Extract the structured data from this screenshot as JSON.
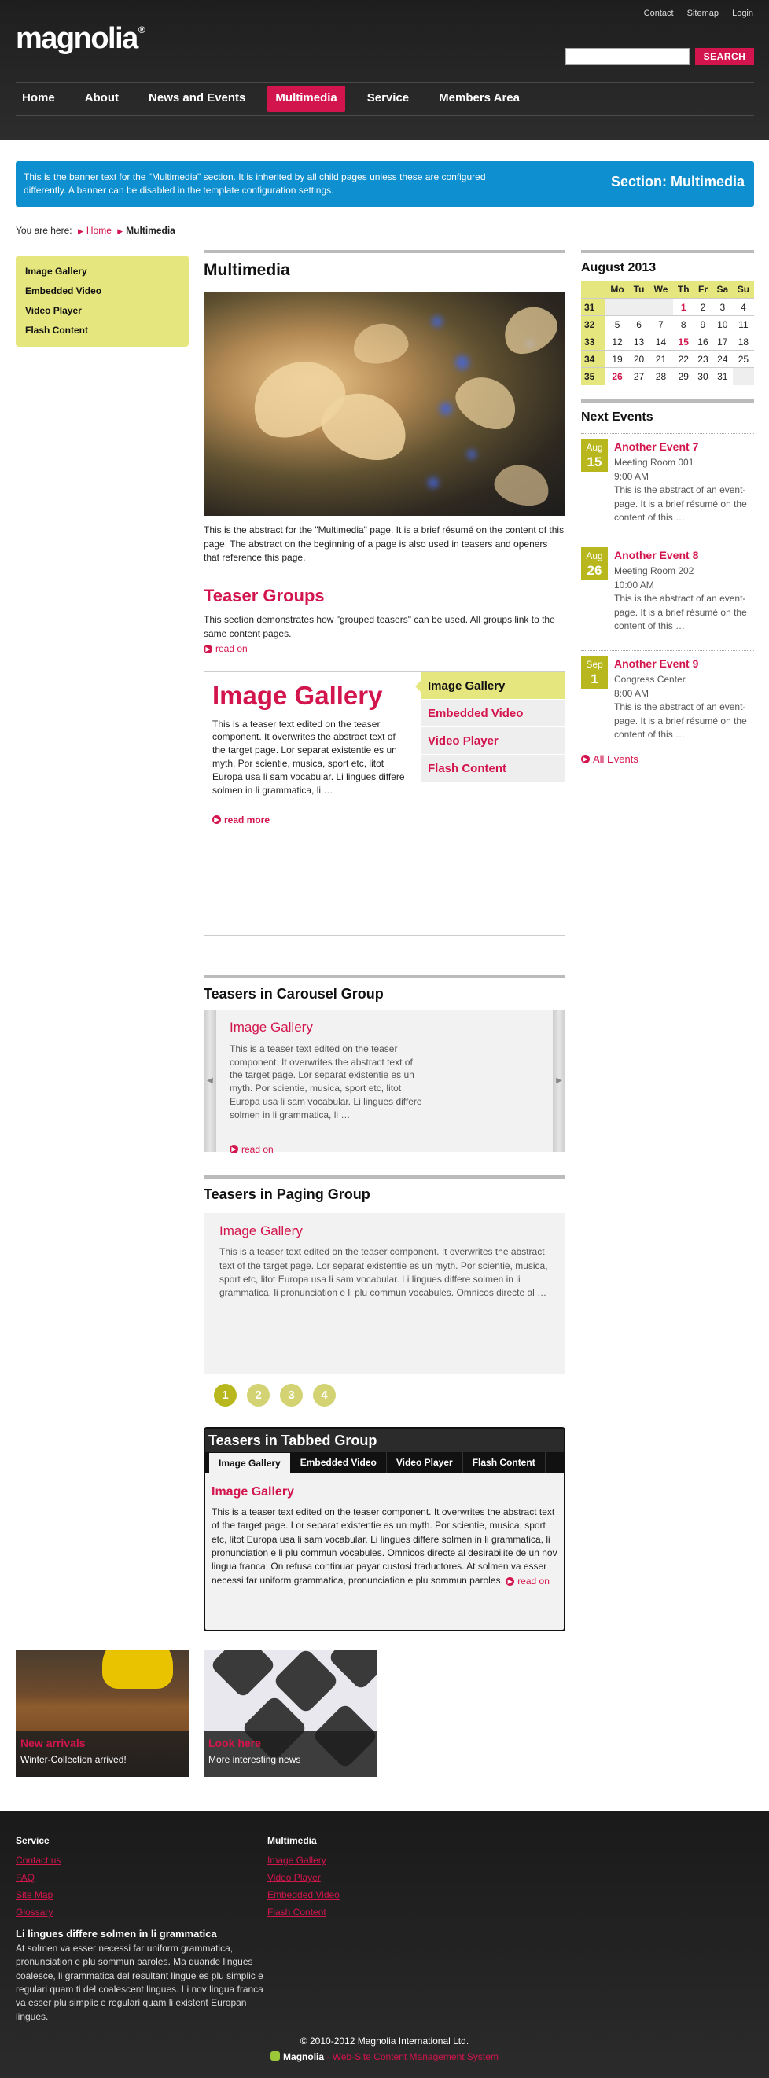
{
  "meta_nav": [
    "Contact",
    "Sitemap",
    "Login"
  ],
  "logo": {
    "text": "magnolia",
    "mark": "®"
  },
  "search": {
    "placeholder": "",
    "button": "SEARCH"
  },
  "main_nav": [
    {
      "label": "Home"
    },
    {
      "label": "About"
    },
    {
      "label": "News and Events"
    },
    {
      "label": "Multimedia",
      "active": true
    },
    {
      "label": "Service"
    },
    {
      "label": "Members Area"
    }
  ],
  "banner": {
    "text": "This is the banner text for the \"Multimedia\" section. It is inherited by all child pages unless these are configured differently. A banner can be disabled in the template configuration settings.",
    "section": "Section: Multimedia"
  },
  "breadcrumb": {
    "prefix": "You are here:",
    "home": "Home",
    "current": "Multimedia"
  },
  "subnav": [
    "Image Gallery",
    "Embedded Video",
    "Video Player",
    "Flash Content"
  ],
  "main": {
    "title": "Multimedia",
    "abstract": "This is the abstract for the \"Multimedia\" page. It is a brief résumé on the content of this page. The abstract on the beginning of a page is also used in teasers and openers that reference this page.",
    "teaser_groups": {
      "title": "Teaser Groups",
      "text": "This section demonstrates how \"grouped teasers\" can be used. All groups link to the same content pages.",
      "readon": "read on"
    },
    "gallery_box": {
      "title": "Image Gallery",
      "text": "This is a teaser text edited on the teaser component. It overwrites the abstract text of the target page. Lor separat existentie es un myth. Por scientie, musica, sport etc, litot Europa usa li sam vocabular. Li lingues differe solmen in li grammatica, li …",
      "readon": "read more",
      "tabs": [
        "Image Gallery",
        "Embedded Video",
        "Video Player",
        "Flash Content"
      ]
    },
    "carousel": {
      "heading": "Teasers in Carousel Group",
      "title": "Image Gallery",
      "text": "This is a teaser text edited on the teaser component. It overwrites the abstract text of the target page. Lor separat existentie es un myth. Por scientie, musica, sport etc, litot Europa usa li sam vocabular. Li lingues differe solmen in li grammatica, li …",
      "readon": "read on"
    },
    "paging": {
      "heading": "Teasers in Paging Group",
      "title": "Image Gallery",
      "text": "This is a teaser text edited on the teaser component. It overwrites the abstract text of the target page. Lor separat existentie es un myth. Por scientie, musica, sport etc, litot Europa usa li sam vocabular. Li lingues differe solmen in li grammatica, li pronunciation e li plu commun vocabules. Omnicos directe al …",
      "pages": [
        "1",
        "2",
        "3",
        "4"
      ]
    },
    "tabbed": {
      "heading": "Teasers in Tabbed Group",
      "tabs": [
        "Image Gallery",
        "Embedded Video",
        "Video Player",
        "Flash Content"
      ],
      "title": "Image Gallery",
      "text": "This is a teaser text edited on the teaser component. It overwrites the abstract text of the target page. Lor separat existentie es un myth. Por scientie, musica, sport etc, litot Europa usa li sam vocabular. Li lingues differe solmen in li grammatica, li pronunciation e li plu commun vocabules. Omnicos directe al desirabilite de un nov lingua franca: On refusa continuar payar custosi traductores. At solmen va esser necessi far uniform grammatica, pronunciation e plu sommun paroles.",
      "readon": "read on"
    }
  },
  "calendar": {
    "title": "August 2013",
    "days": [
      "Mo",
      "Tu",
      "We",
      "Th",
      "Fr",
      "Sa",
      "Su"
    ],
    "weeks": [
      {
        "wk": "31",
        "cells": [
          "",
          "",
          "",
          "1",
          "2",
          "3",
          "4"
        ]
      },
      {
        "wk": "32",
        "cells": [
          "5",
          "6",
          "7",
          "8",
          "9",
          "10",
          "11"
        ]
      },
      {
        "wk": "33",
        "cells": [
          "12",
          "13",
          "14",
          "15",
          "16",
          "17",
          "18"
        ]
      },
      {
        "wk": "34",
        "cells": [
          "19",
          "20",
          "21",
          "22",
          "23",
          "24",
          "25"
        ]
      },
      {
        "wk": "35",
        "cells": [
          "26",
          "27",
          "28",
          "29",
          "30",
          "31",
          ""
        ]
      }
    ],
    "highlight": [
      "1",
      "15",
      "26"
    ]
  },
  "events": {
    "title": "Next Events",
    "items": [
      {
        "month": "Aug",
        "day": "15",
        "title": "Another Event 7",
        "location": "Meeting Room 001",
        "time": "9:00 AM",
        "text": "This is the abstract of an event-page. It is a brief résumé on the content of this …"
      },
      {
        "month": "Aug",
        "day": "26",
        "title": "Another Event 8",
        "location": "Meeting Room 202",
        "time": "10:00 AM",
        "text": "This is the abstract of an event-page. It is a brief résumé on the content of this …"
      },
      {
        "month": "Sep",
        "day": "1",
        "title": "Another Event 9",
        "location": "Congress Center",
        "time": "8:00 AM",
        "text": "This is the abstract of an event-page. It is a brief résumé on the content of this …"
      }
    ],
    "all": "All Events"
  },
  "promos": [
    {
      "title": "New arrivals",
      "subtitle": "Winter-Collection arrived!"
    },
    {
      "title": "Look here",
      "subtitle": "More interesting news"
    }
  ],
  "footer": {
    "col1": {
      "title": "Service",
      "links": [
        "Contact us",
        "FAQ",
        "Site Map",
        "Glossary"
      ]
    },
    "col2": {
      "title": "Multimedia",
      "links": [
        "Image Gallery",
        "Video Player",
        "Embedded Video",
        "Flash Content"
      ]
    },
    "block": {
      "title": "Li lingues differe solmen in li grammatica",
      "text": "At solmen va esser necessi far uniform grammatica, pronunciation e plu sommun paroles. Ma quande lingues coalesce, li grammatica del resultant lingue es plu simplic e regulari quam ti del coalescent lingues. Li nov lingua franca va esser plu simplic e regulari quam li existent Europan lingues."
    },
    "copyright": "© 2010-2012 Magnolia International Ltd.",
    "powered_brand": "Magnolia",
    "powered_text": " - Web-Site Content Management System"
  }
}
